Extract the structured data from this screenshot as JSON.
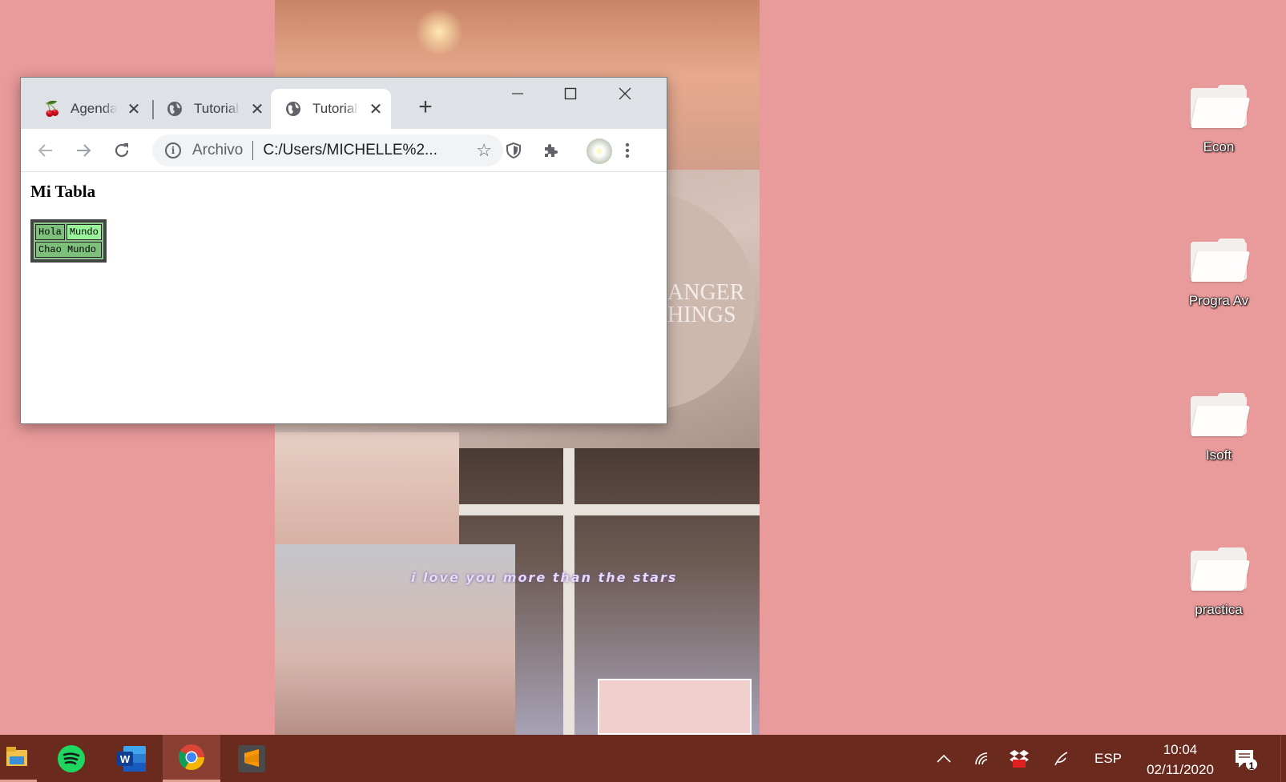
{
  "browser": {
    "tabs": [
      {
        "title": "Agenda",
        "icon": "cherry-icon",
        "active": false
      },
      {
        "title": "Tutorial",
        "icon": "globe-icon",
        "active": false
      },
      {
        "title": "Tutorial",
        "icon": "globe-icon",
        "active": true
      }
    ],
    "new_tab": "+",
    "omnibox": {
      "scheme": "Archivo",
      "url": "C:/Users/MICHELLE%2..."
    },
    "page": {
      "heading": "Mi Tabla",
      "table": [
        [
          "Hola",
          "Mundo"
        ],
        [
          "Chao Mundo"
        ]
      ]
    }
  },
  "wallpaper": {
    "tagline": "i love you more than the stars",
    "poster_text_1": "ANGER",
    "poster_text_2": "HINGS"
  },
  "desktop": {
    "icons": [
      {
        "label": "Econ"
      },
      {
        "label": "Progra Av"
      },
      {
        "label": "Isoft"
      },
      {
        "label": "practica"
      }
    ]
  },
  "taskbar": {
    "apps": [
      "file-explorer-icon",
      "spotify-icon",
      "word-icon",
      "chrome-icon",
      "sublime-text-icon"
    ],
    "language": "ESP",
    "time": "10:04",
    "date": "02/11/2020",
    "notifications": "1"
  },
  "colors": {
    "desktop_bg": "#e99a9a",
    "taskbar_bg": "#6b2a1e",
    "table_cell": "#7cc07c",
    "table_cell_highlight": "#99f199"
  }
}
